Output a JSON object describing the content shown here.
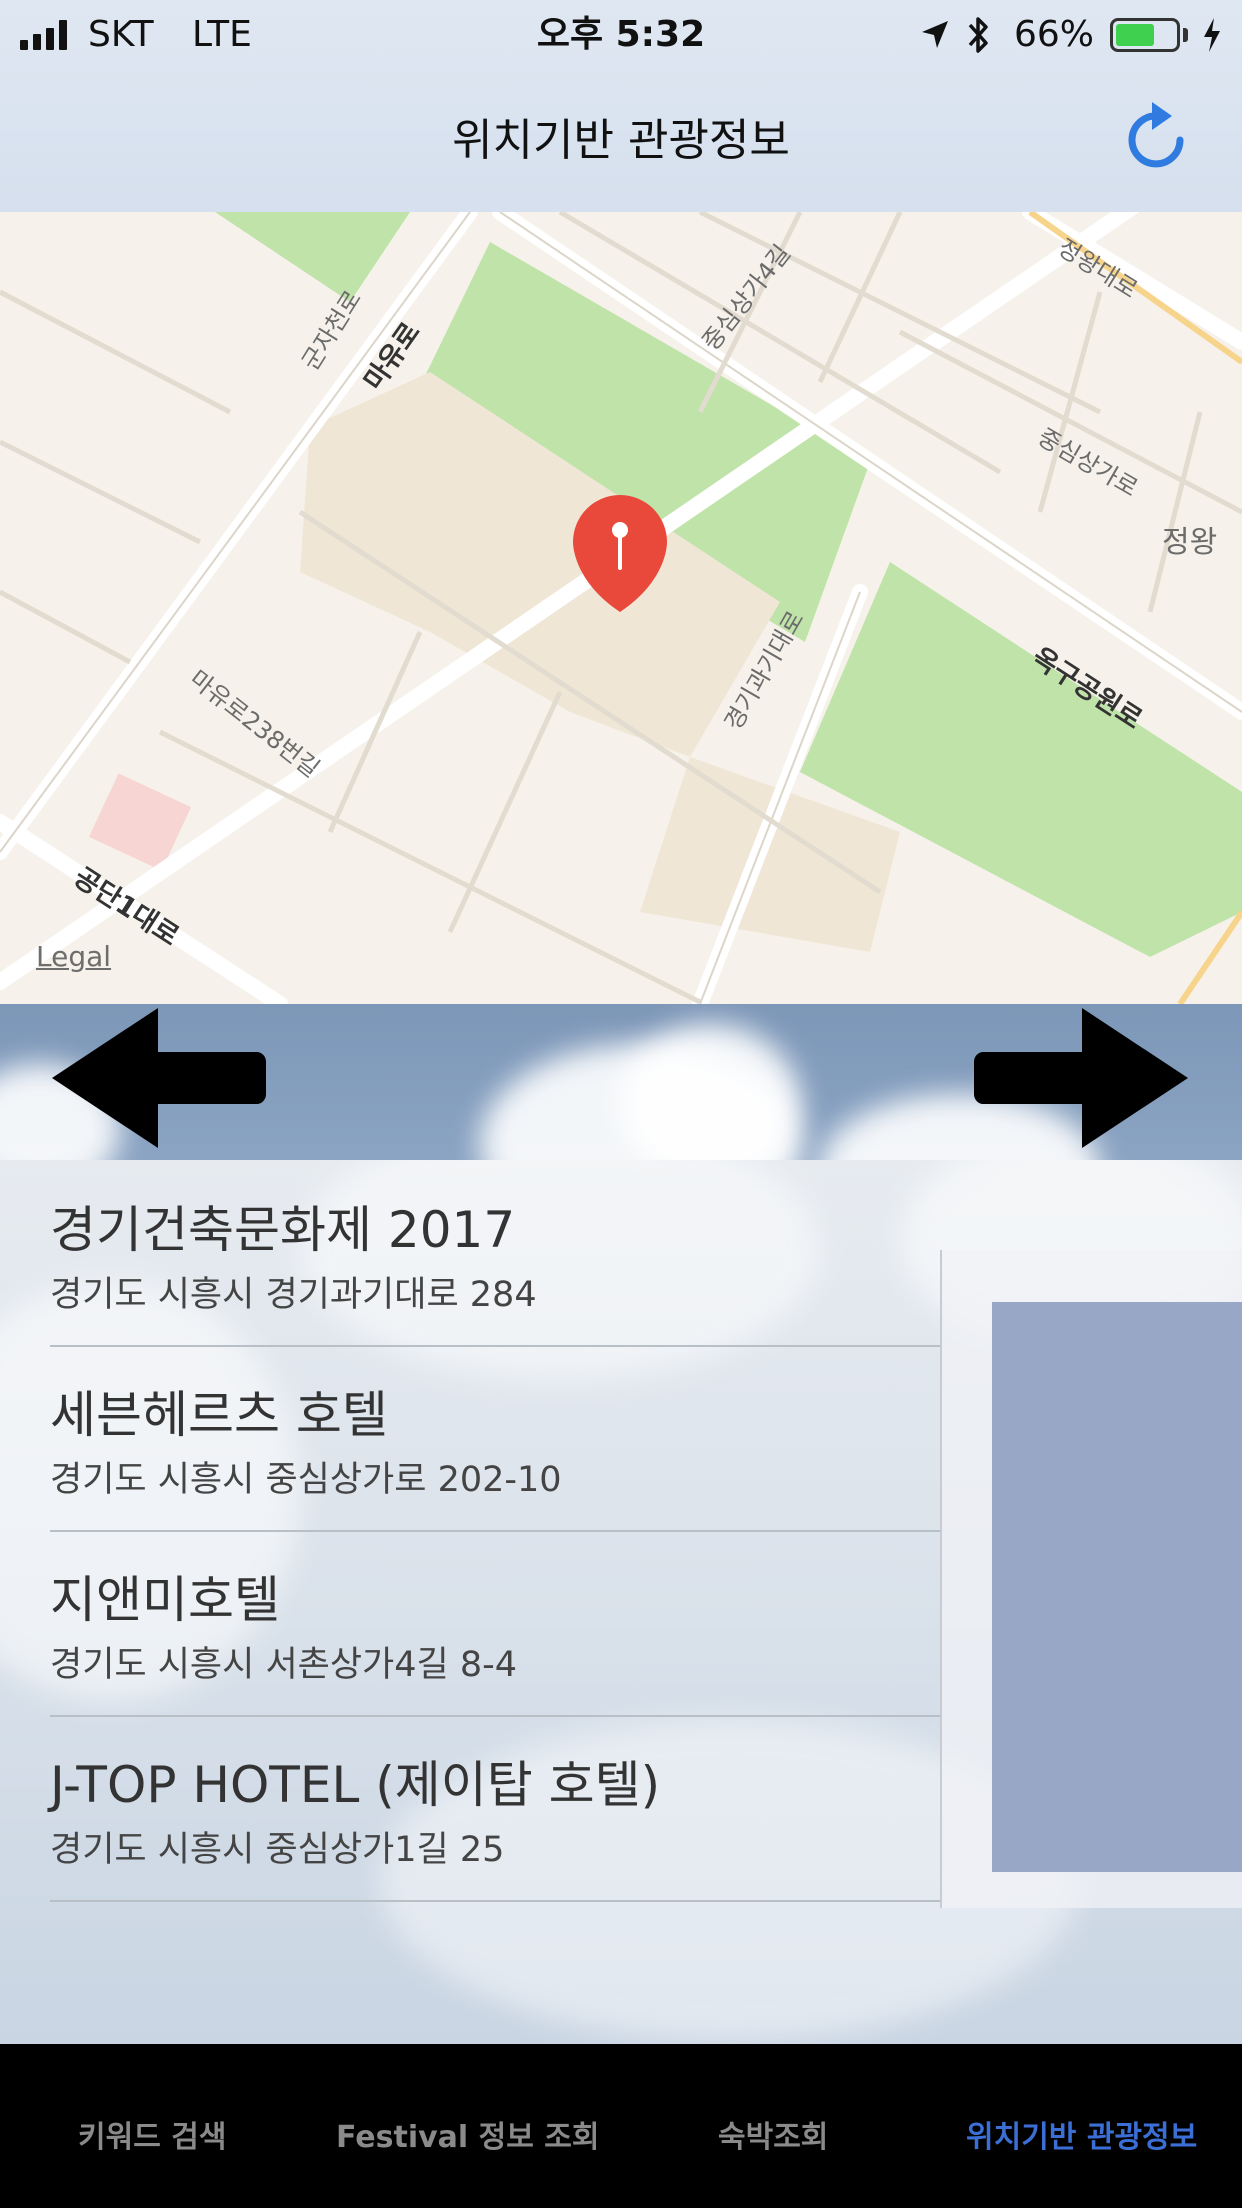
{
  "status_bar": {
    "carrier": "SKT",
    "network": "LTE",
    "time": "오후 5:32",
    "battery": "66%",
    "battery_level": 0.66
  },
  "nav": {
    "title": "위치기반 관광정보",
    "refresh_icon": "refresh-icon"
  },
  "map": {
    "legal": "Legal",
    "roads": {
      "r1": "군자천로",
      "r2": "마유로",
      "r3": "중심상가4길",
      "r4": "정왕대로",
      "r5": "중심상가로",
      "r6": "정왕",
      "r7": "옥구공원로",
      "r8": "경기과기대로",
      "r9": "마유로238번길",
      "r10": "공단1대로"
    },
    "pin_icon": "map-pin-icon"
  },
  "arrows": {
    "left_icon": "arrow-left-icon",
    "right_icon": "arrow-right-icon"
  },
  "list": [
    {
      "title": "경기건축문화제 2017",
      "address": "경기도 시흥시 경기과기대로 284"
    },
    {
      "title": "세븐헤르츠 호텔",
      "address": "경기도 시흥시 중심상가로 202-10"
    },
    {
      "title": "지앤미호텔",
      "address": "경기도 시흥시 서촌상가4길 8-4"
    },
    {
      "title": "J-TOP HOTEL (제이탑 호텔)",
      "address": "경기도 시흥시 중심상가1길 25"
    }
  ],
  "tabs": [
    {
      "label": "키워드 검색"
    },
    {
      "label": "Festival 정보 조회"
    },
    {
      "label": "숙박조회"
    },
    {
      "label": "위치기반 관광정보"
    }
  ],
  "colors": {
    "accent": "#3b6fd6",
    "park": "#bfe3a8",
    "pin": "#e8493b"
  }
}
